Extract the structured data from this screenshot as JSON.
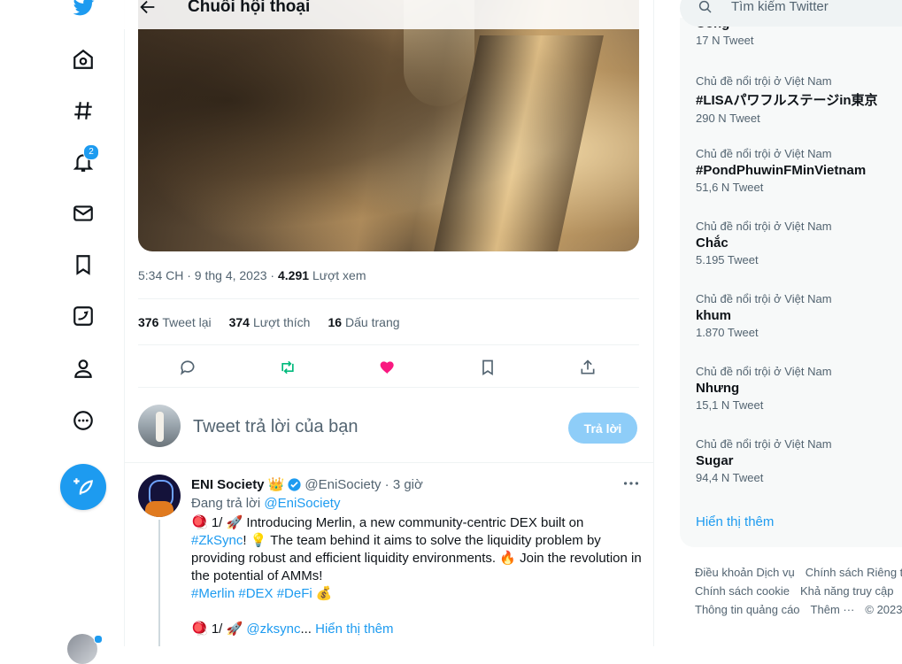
{
  "header": {
    "title": "Chuỗi hội thoại"
  },
  "nav": {
    "notifications_badge": "2"
  },
  "tweet_detail": {
    "timestamp": "5:34 CH · 9 thg 4, 2023",
    "views_count": "4.291",
    "views_label": "Lượt xem",
    "retweets_count": "376",
    "retweets_label": "Tweet lại",
    "likes_count": "374",
    "likes_label": "Lượt thích",
    "bookmarks_count": "16",
    "bookmarks_label": "Dấu trang"
  },
  "reply_box": {
    "placeholder": "Tweet trả lời của bạn",
    "button_label": "Trả lời"
  },
  "reply_tweet": {
    "author_name": "ENI Society",
    "author_emoji": "👑",
    "handle": "@EniSociety",
    "time": "· 3 giờ",
    "replying_prefix": "Đang trả lời",
    "replying_to": "@EniSociety",
    "line1_prefix": "🪀 1/ 🚀 Introducing Merlin, a new community-centric DEX built on",
    "hashtag_zksync": "#ZkSync",
    "line2_rest": "! 💡  The team behind it aims to solve the liquidity problem by providing robust and efficient liquidity environments. 🔥 Join the revolution in the potential of AMMs!",
    "hashtags": "#Merlin #DEX #DeFi",
    "money_emoji": "💰",
    "line4_prefix": "🪀 1/ 🚀",
    "mention_zksync": "@zksync",
    "ellipsis": "...",
    "show_more": "Hiển thị thêm"
  },
  "search": {
    "placeholder": "Tìm kiếm Twitter"
  },
  "trends": {
    "partial": {
      "name": "Công",
      "count": "17 N Tweet"
    },
    "items": [
      {
        "context": "Chủ đề nổi trội ở Việt Nam",
        "name": "#LISAパワフルステージin東京",
        "count": "290 N Tweet"
      },
      {
        "context": "Chủ đề nổi trội ở Việt Nam",
        "name": "#PondPhuwinFMinVietnam",
        "count": "51,6 N Tweet"
      },
      {
        "context": "Chủ đề nổi trội ở Việt Nam",
        "name": "Chắc",
        "count": "5.195 Tweet"
      },
      {
        "context": "Chủ đề nổi trội ở Việt Nam",
        "name": "khum",
        "count": "1.870 Tweet"
      },
      {
        "context": "Chủ đề nổi trội ở Việt Nam",
        "name": "Nhưng",
        "count": "15,1 N Tweet"
      },
      {
        "context": "Chủ đề nổi trội ở Việt Nam",
        "name": "Sugar",
        "count": "94,4 N Tweet"
      }
    ],
    "show_more": "Hiển thị thêm"
  },
  "footer": {
    "links": [
      "Điều khoản Dịch vụ",
      "Chính sách Riêng tư",
      "Chính sách cookie",
      "Khả năng truy cập",
      "Thông tin quảng cáo",
      "Thêm ···",
      "© 2023"
    ]
  },
  "colors": {
    "accent": "#1d9bf0",
    "like": "#f91880",
    "retweet": "#00ba7c"
  }
}
